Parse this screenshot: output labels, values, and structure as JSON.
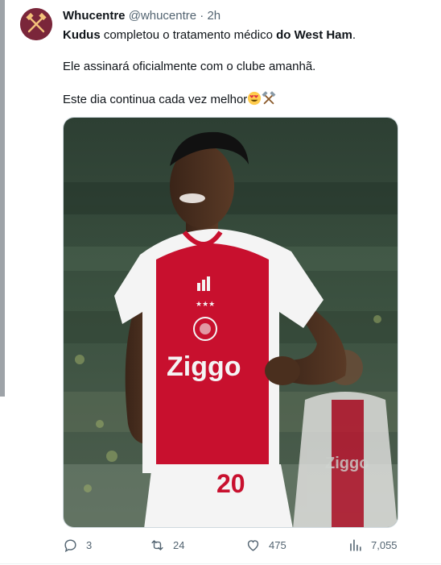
{
  "tweet": {
    "author_name": "Whucentre",
    "handle": "@whucentre",
    "separator": "·",
    "time": "2h",
    "line1_part1": "Kudus",
    "line1_part2": " completou o tratamento  médico ",
    "line1_part3": "do West Ham",
    "line1_part4": ".",
    "line2": "Ele assinará oficialmente com o clube amanhã.",
    "line3": "Este dia continua cada vez melhor",
    "emojis": [
      "heart-eyes-emoji",
      "hammers-emoji"
    ]
  },
  "image": {
    "description_icon": "football-player-photo",
    "jersey_text": "Ziggo",
    "jersey_number": "20",
    "colors": {
      "shirt_red": "#c8102e",
      "shirt_white": "#f4f4f4",
      "stadium_dark": "#24352a"
    }
  },
  "metrics": {
    "replies": "3",
    "reposts": "24",
    "likes": "475",
    "views": "7,055"
  },
  "icons": [
    "reply-icon",
    "repost-icon",
    "like-icon",
    "views-icon"
  ],
  "colors": {
    "text_primary": "#0f1419",
    "text_secondary": "#536471",
    "avatar_bg": "#7a263a"
  }
}
